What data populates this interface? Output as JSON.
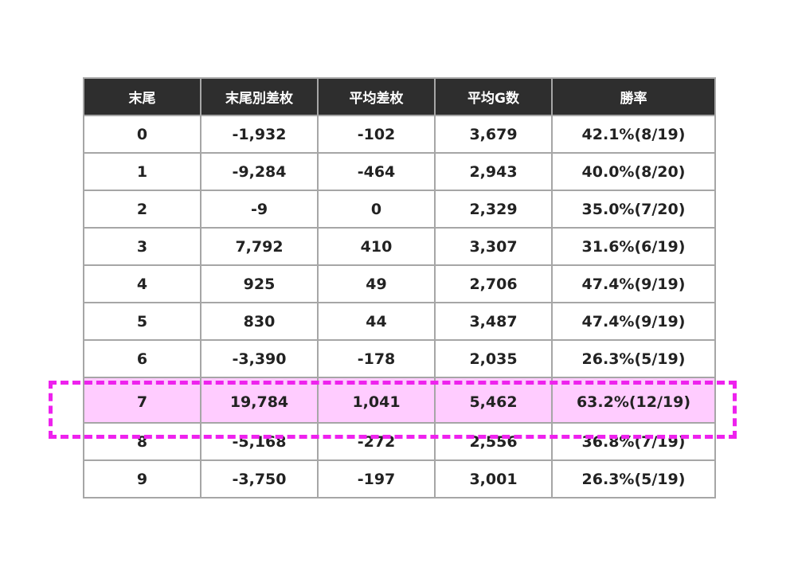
{
  "headers": [
    "末尾",
    "末尾別差枚",
    "平均差枚",
    "平均G数",
    "勝率"
  ],
  "rows": [
    [
      "0",
      "-1,932",
      "-102",
      "3,679",
      "42.1%(8/19)"
    ],
    [
      "1",
      "-9,284",
      "-464",
      "2,943",
      "40.0%(8/20)"
    ],
    [
      "2",
      "-9",
      "0",
      "2,329",
      "35.0%(7/20)"
    ],
    [
      "3",
      "7,792",
      "410",
      "3,307",
      "31.6%(6/19)"
    ],
    [
      "4",
      "925",
      "49",
      "2,706",
      "47.4%(9/19)"
    ],
    [
      "5",
      "830",
      "44",
      "3,487",
      "47.4%(9/19)"
    ],
    [
      "6",
      "-3,390",
      "-178",
      "2,035",
      "26.3%(5/19)"
    ],
    [
      "7",
      "19,784",
      "1,041",
      "5,462",
      "63.2%(12/19)"
    ],
    [
      "8",
      "-5,168",
      "-272",
      "2,556",
      "36.8%(7/19)"
    ],
    [
      "9",
      "-3,750",
      "-197",
      "3,001",
      "26.3%(5/19)"
    ]
  ],
  "highlighted_row": "7",
  "colors": {
    "header_bg": "#2e2e2e",
    "header_text": "#ffffff",
    "highlight_bg": "#ffccff",
    "highlight_border": "#ee22ee",
    "grid": "#a6a6a6"
  }
}
